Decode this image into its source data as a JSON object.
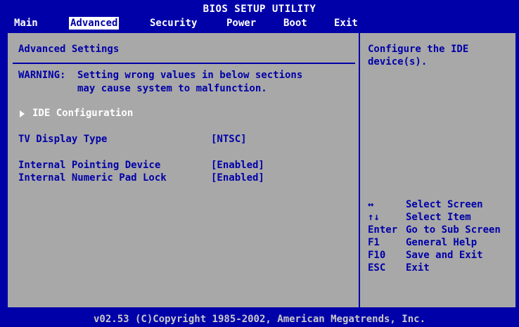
{
  "title": "BIOS SETUP UTILITY",
  "menu": {
    "items": [
      {
        "label": "Main"
      },
      {
        "label": "Advanced"
      },
      {
        "label": "Security"
      },
      {
        "label": "Power"
      },
      {
        "label": "Boot"
      },
      {
        "label": "Exit"
      }
    ],
    "active": "Advanced"
  },
  "main": {
    "heading": "Advanced Settings",
    "warning_label": "WARNING:",
    "warning_line1": "Setting wrong values in below sections",
    "warning_line2": "may cause system to malfunction.",
    "submenu_label": "IDE Configuration",
    "settings": [
      {
        "label": "TV Display Type",
        "value": "[NTSC]"
      },
      {
        "label": "Internal Pointing Device",
        "value": "[Enabled]"
      },
      {
        "label": "Internal Numeric Pad Lock",
        "value": "[Enabled]"
      }
    ]
  },
  "help": {
    "description_line1": "Configure the IDE",
    "description_line2": "device(s).",
    "keys": [
      {
        "key": "↔",
        "action": "Select Screen"
      },
      {
        "key": "↑↓",
        "action": "Select Item"
      },
      {
        "key": "Enter",
        "action": "Go to Sub Screen"
      },
      {
        "key": "F1",
        "action": "General Help"
      },
      {
        "key": "F10",
        "action": "Save and Exit"
      },
      {
        "key": "ESC",
        "action": "Exit"
      }
    ]
  },
  "footer": "v02.53 (C)Copyright 1985-2002, American Megatrends, Inc.",
  "colors": {
    "background": "#0000a8",
    "panel": "#a8a8a8",
    "highlight_text": "#ffffff"
  }
}
